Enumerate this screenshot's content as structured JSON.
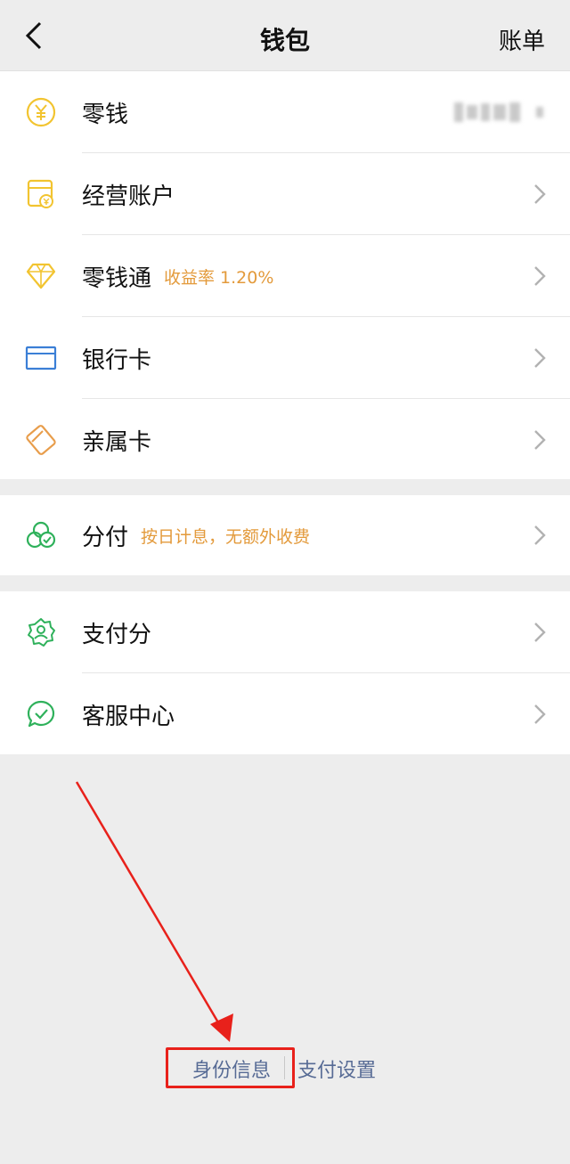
{
  "header": {
    "title": "钱包",
    "bill_label": "账单"
  },
  "groups": {
    "wallet": [
      {
        "label": "零钱",
        "icon": "yuan-coin-icon",
        "balance_hidden": true
      },
      {
        "label": "经营账户",
        "icon": "shop-account-icon"
      },
      {
        "label": "零钱通",
        "icon": "diamond-icon",
        "tag": "收益率 1.20%"
      },
      {
        "label": "银行卡",
        "icon": "bank-card-icon"
      },
      {
        "label": "亲属卡",
        "icon": "family-card-icon"
      }
    ],
    "credit": [
      {
        "label": "分付",
        "icon": "installment-icon",
        "tag": "按日计息，无额外收费"
      }
    ],
    "services": [
      {
        "label": "支付分",
        "icon": "pay-score-icon"
      },
      {
        "label": "客服中心",
        "icon": "customer-service-icon"
      }
    ]
  },
  "footer": {
    "identity_label": "身份信息",
    "settings_label": "支付设置"
  },
  "colors": {
    "background": "#ededed",
    "link": "#576b95",
    "tag": "#e39a3b",
    "yellow_icon": "#f2c430",
    "blue_icon": "#3b7fd6",
    "orange_icon": "#e89d4b",
    "green_icon": "#2fb15b",
    "annotation": "#e8211b"
  }
}
